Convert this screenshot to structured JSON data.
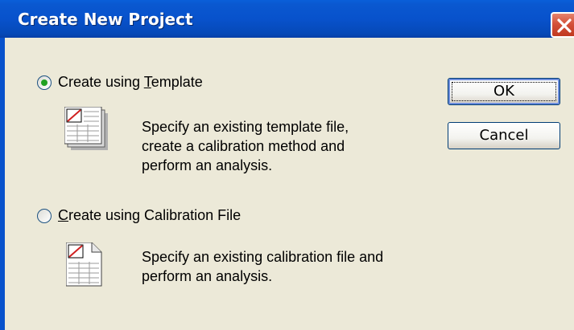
{
  "window": {
    "title": "Create New Project"
  },
  "options": [
    {
      "label_prefix": "Create using ",
      "label_mnemonic": "T",
      "label_suffix": "emplate",
      "selected": true,
      "description_lines": [
        "Specify an existing template file,",
        "create a calibration method and",
        "perform an analysis."
      ],
      "icon": "template-document-icon"
    },
    {
      "label_prefix": "",
      "label_mnemonic": "C",
      "label_suffix": "reate using Calibration File",
      "selected": false,
      "description_lines": [
        "Specify an existing calibration file and",
        "perform an analysis."
      ],
      "icon": "calibration-document-icon"
    }
  ],
  "buttons": {
    "ok_label": "OK",
    "cancel_label": "Cancel"
  }
}
